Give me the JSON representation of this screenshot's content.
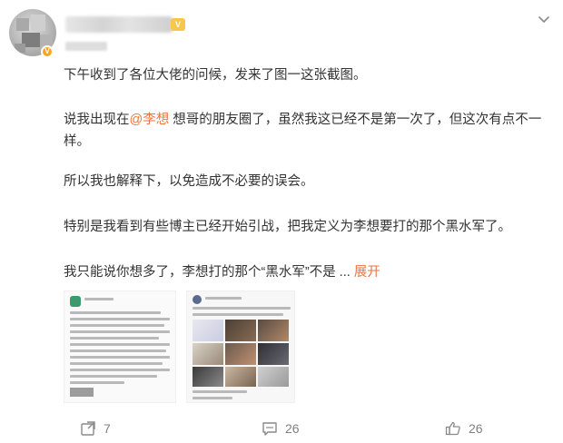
{
  "post": {
    "paragraphs": {
      "p1": "下午收到了各位大佬的问候，发来了图一这张截图。",
      "p2_before": "说我出现在",
      "p2_mention": "@李想",
      "p2_after": " 想哥的朋友圈了，虽然我这已经不是第一次了，但这次有点不一样。",
      "p3": "所以我也解释下，以免造成不必要的误会。",
      "p4": "特别是我看到有些博主已经开始引战，把我定义为李想要打的那个黑水军了。",
      "p5": "我只能说你想多了，李想打的那个“黑水军”不是 ...",
      "expand_label": "展开"
    }
  },
  "footer": {
    "repost_count": "7",
    "comment_count": "26",
    "like_count": "26"
  },
  "icons": {
    "more": "chevron-down-icon",
    "repost": "repost-icon",
    "comment": "comment-icon",
    "like": "thumbs-up-icon"
  },
  "colors": {
    "accent": "#eb7340",
    "text": "#333333",
    "muted": "#808080"
  }
}
